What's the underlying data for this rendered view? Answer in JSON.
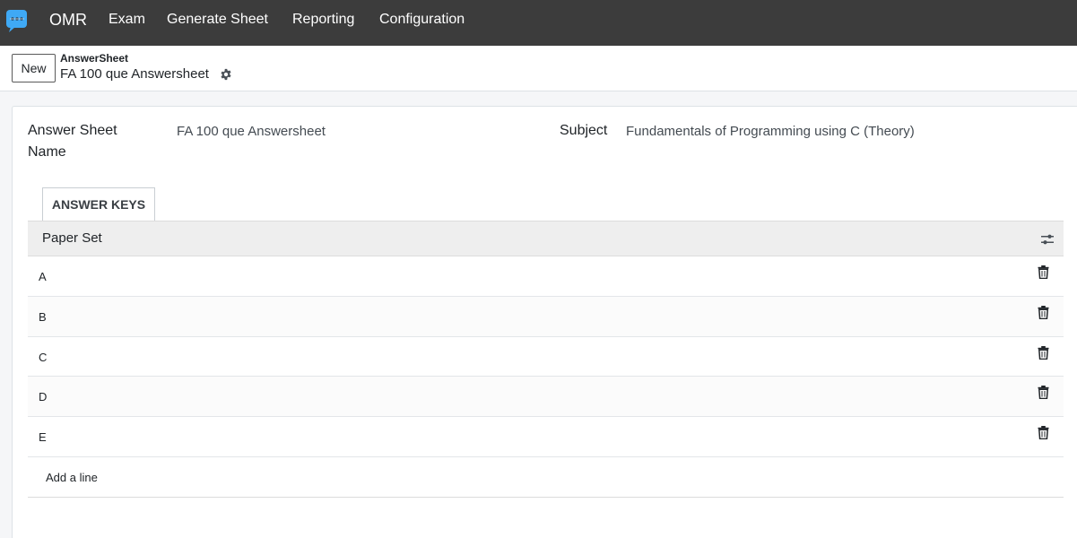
{
  "navbar": {
    "app_name": "OMR",
    "menus": [
      "Exam",
      "Generate Sheet",
      "Reporting",
      "Configuration"
    ],
    "logo_icon": "omr-logo-icon"
  },
  "control_panel": {
    "new_label": "New",
    "breadcrumb_parent": "AnswerSheet",
    "breadcrumb_current": "FA 100 que Answersheet",
    "gear_icon": "gear-icon"
  },
  "form": {
    "name_label": "Answer Sheet Name",
    "name_value": "FA 100 que Answersheet",
    "subject_label": "Subject",
    "subject_value": "Fundamentals of Programming using C (Theory)"
  },
  "tabs": [
    {
      "label": "ANSWER KEYS"
    }
  ],
  "table": {
    "header": "Paper Set",
    "rows": [
      "A",
      "B",
      "C",
      "D",
      "E"
    ],
    "add_line": "Add a line"
  },
  "colors": {
    "navbar_bg": "#3c3c3c",
    "logo_blue": "#3fa9f5"
  }
}
